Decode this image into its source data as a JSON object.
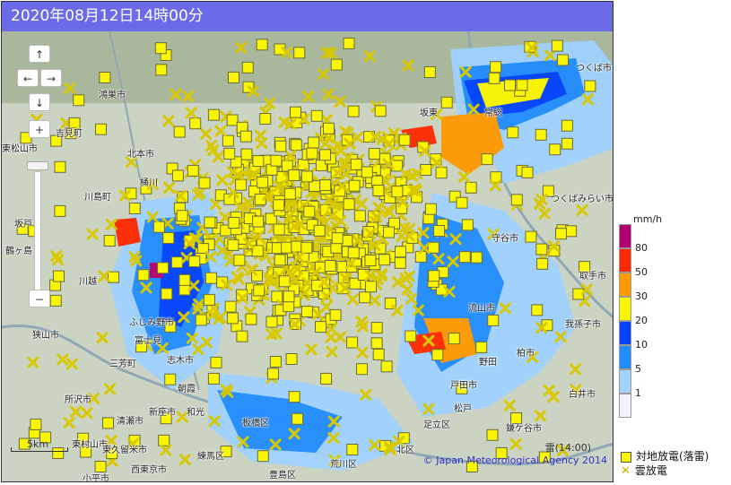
{
  "header": {
    "title": "2020年08月12日14時00分"
  },
  "controls": {
    "up": "↑",
    "left": "←",
    "right": "→",
    "down": "↓",
    "zoom_in": "+",
    "zoom_out": "−"
  },
  "map": {
    "scale_label": "5km",
    "timestamp": "雷(14:00)",
    "copyright": "© Japan Meteorological Agency 2014",
    "place_labels": [
      "つくば市",
      "鴻巣市",
      "吉見町",
      "北本市",
      "東松山市",
      "坂戸",
      "鶴ヶ島",
      "川越",
      "川島町",
      "桶川",
      "坂東",
      "常総",
      "守谷市",
      "つくばみらい市",
      "取手市",
      "我孫子市",
      "柏市",
      "松戸",
      "白井市",
      "鎌ケ谷市",
      "三芳町",
      "所沢市",
      "狭山市",
      "志木市",
      "朝霞",
      "新座市",
      "清瀬市",
      "東村山市",
      "東久留米市",
      "西東京市",
      "小平市",
      "練馬区",
      "板橋区",
      "北区",
      "荒川区",
      "足立区",
      "豊島区",
      "流山市",
      "野田",
      "富士見",
      "ふじみ野市",
      "戸田市",
      "和光"
    ]
  },
  "legend": {
    "unit": "mm/h",
    "levels": [
      {
        "value": "80",
        "color": "#b4006e"
      },
      {
        "value": "50",
        "color": "#ff2800"
      },
      {
        "value": "30",
        "color": "#ff9900"
      },
      {
        "value": "20",
        "color": "#faf500"
      },
      {
        "value": "10",
        "color": "#0041ff"
      },
      {
        "value": "5",
        "color": "#218cff"
      },
      {
        "value": "1",
        "color": "#a0d2ff"
      },
      {
        "value": "",
        "color": "#f2f2ff"
      }
    ]
  },
  "keys": {
    "ground_strike": "対地放電(落雷)",
    "cloud_discharge": "雲放電"
  }
}
